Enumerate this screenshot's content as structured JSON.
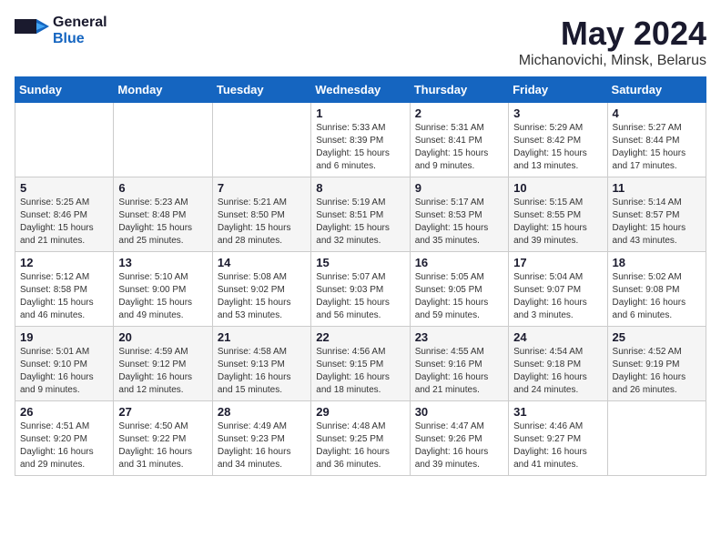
{
  "logo": {
    "general": "General",
    "blue": "Blue"
  },
  "title": "May 2024",
  "subtitle": "Michanovichi, Minsk, Belarus",
  "headers": [
    "Sunday",
    "Monday",
    "Tuesday",
    "Wednesday",
    "Thursday",
    "Friday",
    "Saturday"
  ],
  "weeks": [
    [
      {
        "day": "",
        "info": ""
      },
      {
        "day": "",
        "info": ""
      },
      {
        "day": "",
        "info": ""
      },
      {
        "day": "1",
        "info": "Sunrise: 5:33 AM\nSunset: 8:39 PM\nDaylight: 15 hours\nand 6 minutes."
      },
      {
        "day": "2",
        "info": "Sunrise: 5:31 AM\nSunset: 8:41 PM\nDaylight: 15 hours\nand 9 minutes."
      },
      {
        "day": "3",
        "info": "Sunrise: 5:29 AM\nSunset: 8:42 PM\nDaylight: 15 hours\nand 13 minutes."
      },
      {
        "day": "4",
        "info": "Sunrise: 5:27 AM\nSunset: 8:44 PM\nDaylight: 15 hours\nand 17 minutes."
      }
    ],
    [
      {
        "day": "5",
        "info": "Sunrise: 5:25 AM\nSunset: 8:46 PM\nDaylight: 15 hours\nand 21 minutes."
      },
      {
        "day": "6",
        "info": "Sunrise: 5:23 AM\nSunset: 8:48 PM\nDaylight: 15 hours\nand 25 minutes."
      },
      {
        "day": "7",
        "info": "Sunrise: 5:21 AM\nSunset: 8:50 PM\nDaylight: 15 hours\nand 28 minutes."
      },
      {
        "day": "8",
        "info": "Sunrise: 5:19 AM\nSunset: 8:51 PM\nDaylight: 15 hours\nand 32 minutes."
      },
      {
        "day": "9",
        "info": "Sunrise: 5:17 AM\nSunset: 8:53 PM\nDaylight: 15 hours\nand 35 minutes."
      },
      {
        "day": "10",
        "info": "Sunrise: 5:15 AM\nSunset: 8:55 PM\nDaylight: 15 hours\nand 39 minutes."
      },
      {
        "day": "11",
        "info": "Sunrise: 5:14 AM\nSunset: 8:57 PM\nDaylight: 15 hours\nand 43 minutes."
      }
    ],
    [
      {
        "day": "12",
        "info": "Sunrise: 5:12 AM\nSunset: 8:58 PM\nDaylight: 15 hours\nand 46 minutes."
      },
      {
        "day": "13",
        "info": "Sunrise: 5:10 AM\nSunset: 9:00 PM\nDaylight: 15 hours\nand 49 minutes."
      },
      {
        "day": "14",
        "info": "Sunrise: 5:08 AM\nSunset: 9:02 PM\nDaylight: 15 hours\nand 53 minutes."
      },
      {
        "day": "15",
        "info": "Sunrise: 5:07 AM\nSunset: 9:03 PM\nDaylight: 15 hours\nand 56 minutes."
      },
      {
        "day": "16",
        "info": "Sunrise: 5:05 AM\nSunset: 9:05 PM\nDaylight: 15 hours\nand 59 minutes."
      },
      {
        "day": "17",
        "info": "Sunrise: 5:04 AM\nSunset: 9:07 PM\nDaylight: 16 hours\nand 3 minutes."
      },
      {
        "day": "18",
        "info": "Sunrise: 5:02 AM\nSunset: 9:08 PM\nDaylight: 16 hours\nand 6 minutes."
      }
    ],
    [
      {
        "day": "19",
        "info": "Sunrise: 5:01 AM\nSunset: 9:10 PM\nDaylight: 16 hours\nand 9 minutes."
      },
      {
        "day": "20",
        "info": "Sunrise: 4:59 AM\nSunset: 9:12 PM\nDaylight: 16 hours\nand 12 minutes."
      },
      {
        "day": "21",
        "info": "Sunrise: 4:58 AM\nSunset: 9:13 PM\nDaylight: 16 hours\nand 15 minutes."
      },
      {
        "day": "22",
        "info": "Sunrise: 4:56 AM\nSunset: 9:15 PM\nDaylight: 16 hours\nand 18 minutes."
      },
      {
        "day": "23",
        "info": "Sunrise: 4:55 AM\nSunset: 9:16 PM\nDaylight: 16 hours\nand 21 minutes."
      },
      {
        "day": "24",
        "info": "Sunrise: 4:54 AM\nSunset: 9:18 PM\nDaylight: 16 hours\nand 24 minutes."
      },
      {
        "day": "25",
        "info": "Sunrise: 4:52 AM\nSunset: 9:19 PM\nDaylight: 16 hours\nand 26 minutes."
      }
    ],
    [
      {
        "day": "26",
        "info": "Sunrise: 4:51 AM\nSunset: 9:20 PM\nDaylight: 16 hours\nand 29 minutes."
      },
      {
        "day": "27",
        "info": "Sunrise: 4:50 AM\nSunset: 9:22 PM\nDaylight: 16 hours\nand 31 minutes."
      },
      {
        "day": "28",
        "info": "Sunrise: 4:49 AM\nSunset: 9:23 PM\nDaylight: 16 hours\nand 34 minutes."
      },
      {
        "day": "29",
        "info": "Sunrise: 4:48 AM\nSunset: 9:25 PM\nDaylight: 16 hours\nand 36 minutes."
      },
      {
        "day": "30",
        "info": "Sunrise: 4:47 AM\nSunset: 9:26 PM\nDaylight: 16 hours\nand 39 minutes."
      },
      {
        "day": "31",
        "info": "Sunrise: 4:46 AM\nSunset: 9:27 PM\nDaylight: 16 hours\nand 41 minutes."
      },
      {
        "day": "",
        "info": ""
      }
    ]
  ]
}
